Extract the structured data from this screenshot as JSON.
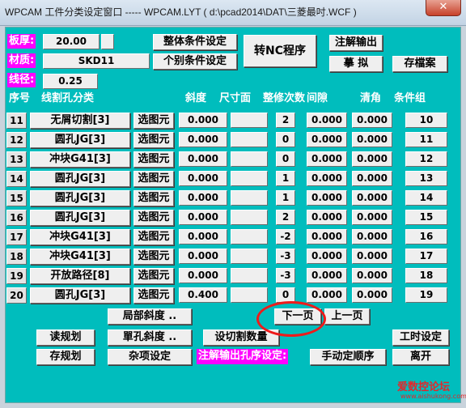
{
  "window": {
    "title": "WPCAM 工件分类设定窗口 ----- WPCAM.LYT ( d:\\pcad2014\\DAT\\三菱最吋.WCF )",
    "close_glyph": "✕"
  },
  "top": {
    "thickness_label": "板厚:",
    "thickness_value": "20.00",
    "material_label": "材质:",
    "material_value": "SKD11",
    "wire_label": "线径:",
    "wire_value": "0.25",
    "overall_condition_button": "整体条件设定",
    "individual_condition_button": "个别条件设定",
    "convert_nc_button": "转NC程序",
    "annotation_output_button": "注解输出",
    "simulate_button": "摹 拟",
    "save_button": "存檔案"
  },
  "table": {
    "headers": [
      "序号",
      "线割孔分类",
      "斜度",
      "尺寸面",
      "整修次数",
      "间隙",
      "清角",
      "条件组"
    ],
    "select_label": "选图元",
    "rows": [
      {
        "no": "11",
        "type": "无屑切割[3]",
        "taper": "0.000",
        "surface": "",
        "passes": "2",
        "gap": "0.000",
        "clear": "0.000",
        "group": "10"
      },
      {
        "no": "12",
        "type": "圆孔JG[3]",
        "taper": "0.000",
        "surface": "",
        "passes": "0",
        "gap": "0.000",
        "clear": "0.000",
        "group": "11"
      },
      {
        "no": "13",
        "type": "冲块G41[3]",
        "taper": "0.000",
        "surface": "",
        "passes": "0",
        "gap": "0.000",
        "clear": "0.000",
        "group": "12"
      },
      {
        "no": "14",
        "type": "圆孔JG[3]",
        "taper": "0.000",
        "surface": "",
        "passes": "1",
        "gap": "0.000",
        "clear": "0.000",
        "group": "13"
      },
      {
        "no": "15",
        "type": "圆孔JG[3]",
        "taper": "0.000",
        "surface": "",
        "passes": "1",
        "gap": "0.000",
        "clear": "0.000",
        "group": "14"
      },
      {
        "no": "16",
        "type": "圆孔JG[3]",
        "taper": "0.000",
        "surface": "",
        "passes": "2",
        "gap": "0.000",
        "clear": "0.000",
        "group": "15"
      },
      {
        "no": "17",
        "type": "冲块G41[3]",
        "taper": "0.000",
        "surface": "",
        "passes": "-2",
        "gap": "0.000",
        "clear": "0.000",
        "group": "16"
      },
      {
        "no": "18",
        "type": "冲块G41[3]",
        "taper": "0.000",
        "surface": "",
        "passes": "-3",
        "gap": "0.000",
        "clear": "0.000",
        "group": "17"
      },
      {
        "no": "19",
        "type": "开放路径[8]",
        "taper": "0.000",
        "surface": "",
        "passes": "-3",
        "gap": "0.000",
        "clear": "0.000",
        "group": "18"
      },
      {
        "no": "20",
        "type": "圆孔JG[3]",
        "taper": "0.400",
        "surface": "",
        "passes": "0",
        "gap": "0.000",
        "clear": "0.000",
        "group": "19"
      }
    ]
  },
  "bottom": {
    "local_taper": "局部斜度 ..",
    "next_page": "下一页",
    "prev_page": "上一页",
    "read_plan": "读规划",
    "single_hole_taper": "單孔斜度 ..",
    "set_cut_count": "设切割数量",
    "work_hours": "工时设定",
    "save_plan": "存规划",
    "misc_settings": "杂项设定",
    "annotation_order_label": "注解输出孔序设定:",
    "manual_order": "手动定顺序",
    "exit": "离开"
  },
  "watermark": {
    "text": "爱数控论坛",
    "url": "www.aishukong.com"
  },
  "colors": {
    "background": "#00bdbd",
    "label_magenta": "#ff00ff",
    "highlight_circle": "#ee1b1b"
  }
}
